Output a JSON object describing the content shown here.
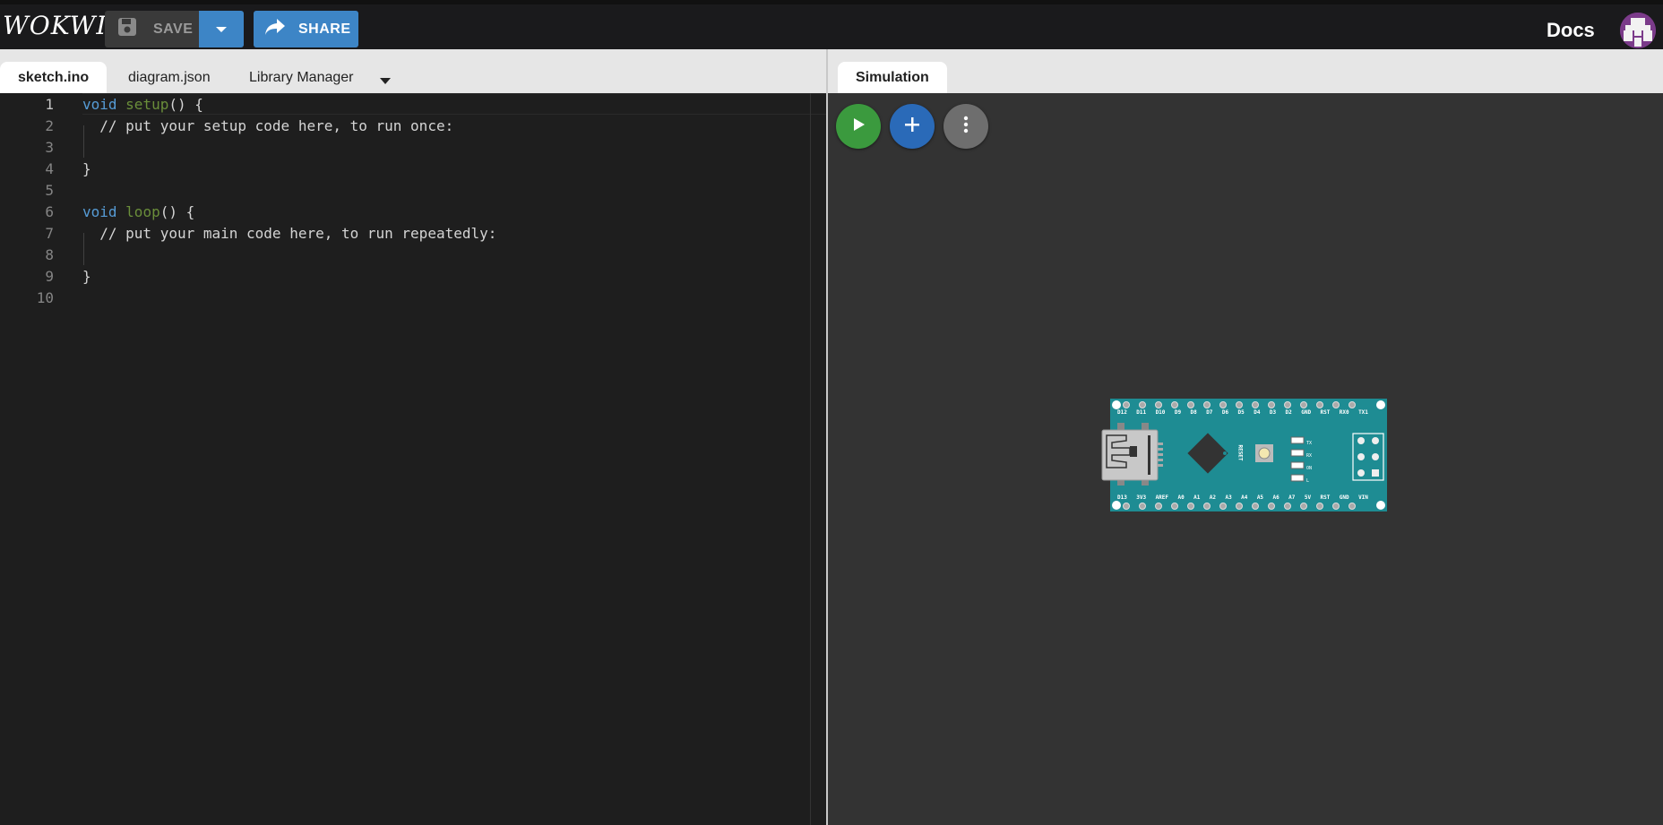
{
  "app": {
    "logo": "WOKWI"
  },
  "toolbar": {
    "save_label": "SAVE",
    "share_label": "SHARE",
    "docs_label": "Docs"
  },
  "editor_tabs": [
    {
      "label": "sketch.ino",
      "active": true
    },
    {
      "label": "diagram.json",
      "active": false
    },
    {
      "label": "Library Manager",
      "active": false
    }
  ],
  "sim_tabs": [
    {
      "label": "Simulation",
      "active": true
    }
  ],
  "code_lines": [
    {
      "num": "1",
      "text": "void setup() {"
    },
    {
      "num": "2",
      "text": "  // put your setup code here, to run once:"
    },
    {
      "num": "3",
      "text": ""
    },
    {
      "num": "4",
      "text": "}"
    },
    {
      "num": "5",
      "text": ""
    },
    {
      "num": "6",
      "text": "void loop() {"
    },
    {
      "num": "7",
      "text": "  // put your main code here, to run repeatedly:"
    },
    {
      "num": "8",
      "text": ""
    },
    {
      "num": "9",
      "text": "}"
    },
    {
      "num": "10",
      "text": ""
    }
  ],
  "board": {
    "top_pins": [
      "D12",
      "D11",
      "D10",
      "D9",
      "D8",
      "D7",
      "D6",
      "D5",
      "D4",
      "D3",
      "D2",
      "GND",
      "RST",
      "RX0",
      "TX1"
    ],
    "bottom_pins": [
      "D13",
      "3V3",
      "AREF",
      "A0",
      "A1",
      "A2",
      "A3",
      "A4",
      "A5",
      "A6",
      "A7",
      "5V",
      "RST",
      "GND",
      "VIN"
    ],
    "reset_label": "RESET",
    "led_labels": [
      "TX",
      "RX",
      "ON",
      "L"
    ]
  },
  "colors": {
    "accent": "#3d85c6",
    "play": "#3b9a3e",
    "board": "#1e8c93"
  }
}
